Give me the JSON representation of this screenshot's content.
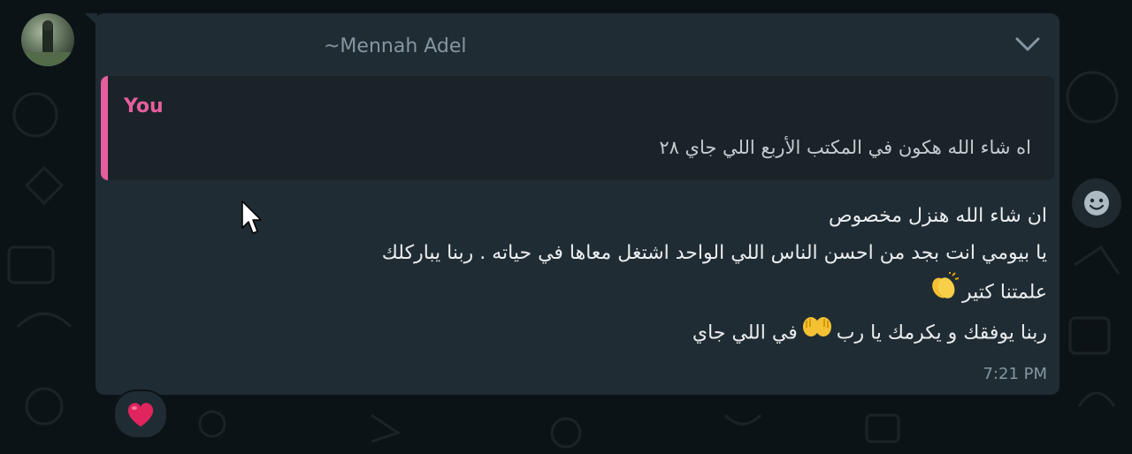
{
  "message": {
    "sender_name": "~Mennah Adel",
    "quote": {
      "author": "You",
      "text": "اه شاء الله هكون في المكتب الأربع اللي جاي ٢٨"
    },
    "lines": [
      "ان شاء الله هنزل مخصوص",
      "يا بيومي انت بجد من احسن الناس اللي الواحد اشتغل معاها في حياته . ربنا يباركلك",
      "علمتنا كتير",
      "ربنا يوفقك و يكرمك يا رب",
      "في اللي جاي"
    ],
    "time": "7:21 PM",
    "reaction": "heart"
  },
  "icons": {
    "menu": "chevron-down-icon",
    "react": "smiley-icon",
    "reaction": "heart-icon",
    "clap": "clapping-hands-emoji",
    "raise": "raising-hands-emoji"
  },
  "colors": {
    "bubble": "#202c33",
    "quote_accent": "#e65e9f",
    "heart": "#e0245e"
  }
}
